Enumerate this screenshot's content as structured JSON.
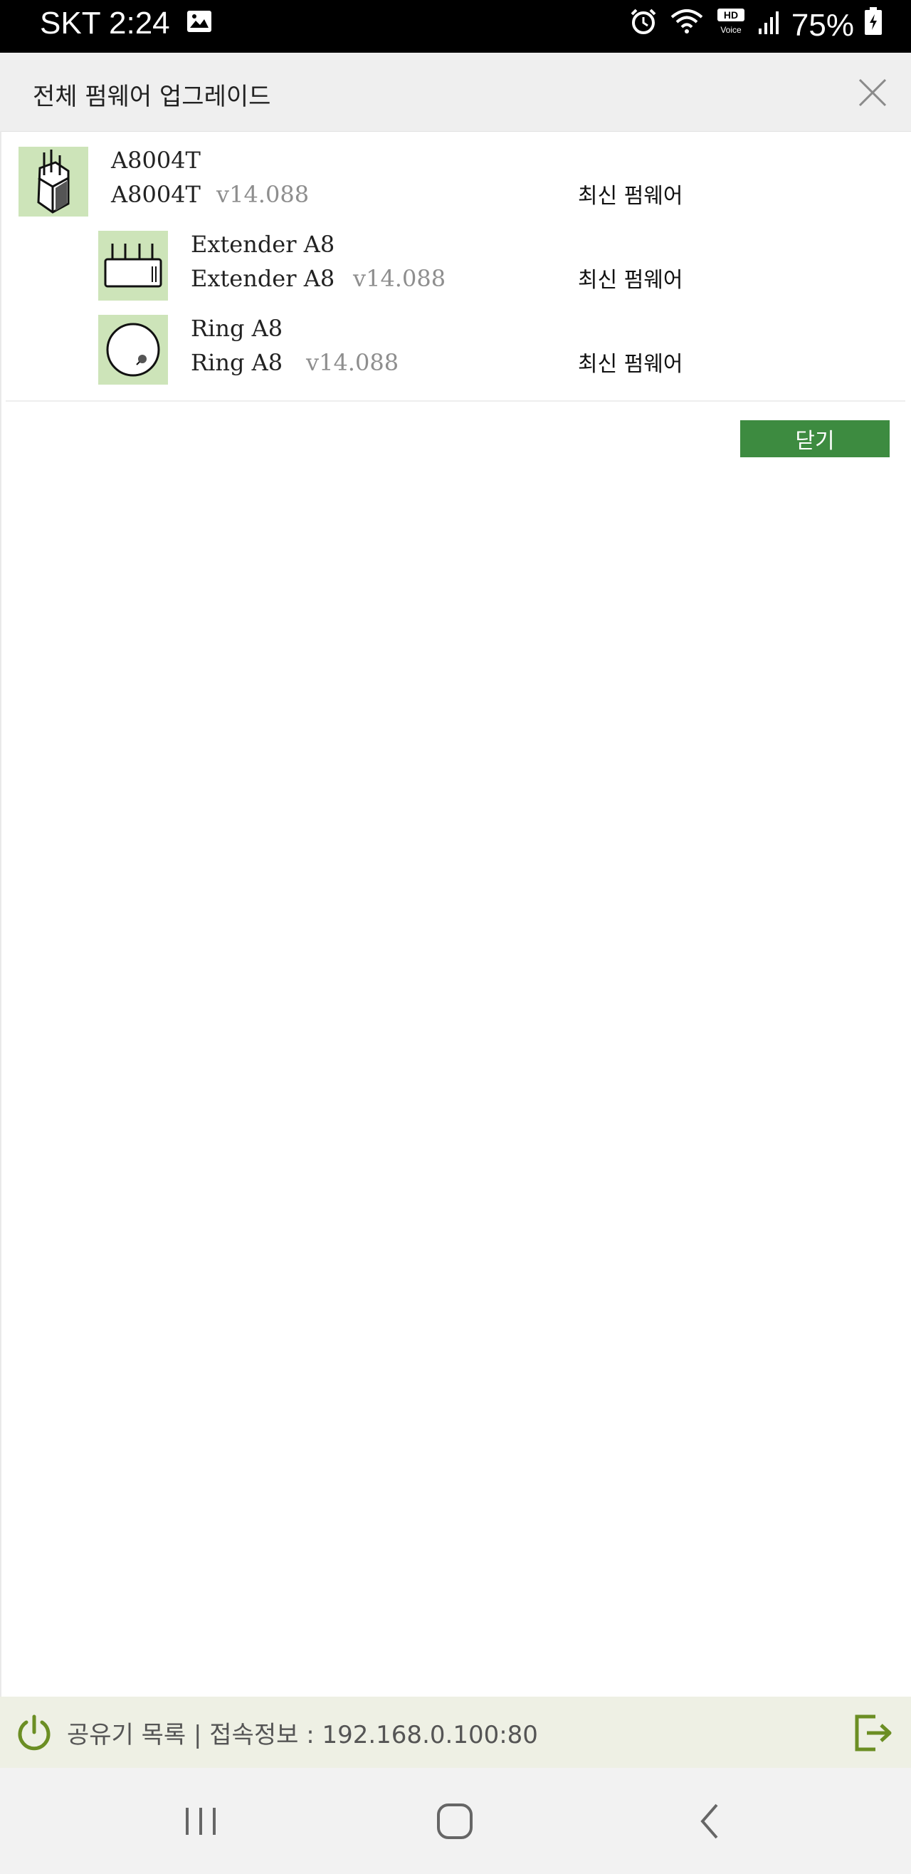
{
  "status_bar": {
    "carrier_time": "SKT 2:24",
    "battery": "75%",
    "icons": [
      "image-icon",
      "alarm-icon",
      "wifi-icon",
      "hd-voice-icon",
      "signal-icon",
      "battery-icon"
    ]
  },
  "dialog": {
    "title": "전체 펌웨어 업그레이드",
    "close_icon": "close-icon"
  },
  "devices": [
    {
      "name": "A8004T",
      "model": "A8004T",
      "version": "v14.088",
      "status": "최신 펌웨어",
      "icon": "router-icon"
    },
    {
      "name": "Extender A8",
      "model": "Extender A8",
      "version": "v14.088",
      "status": "최신 펌웨어",
      "icon": "extender-icon"
    },
    {
      "name": "Ring A8",
      "model": "Ring A8",
      "version": "v14.088",
      "status": "최신 펌웨어",
      "icon": "ring-icon"
    }
  ],
  "buttons": {
    "close": "닫기"
  },
  "info_bar": {
    "text": "공유기 목록  |  접속정보 : 192.168.0.100:80"
  },
  "colors": {
    "accent_green": "#3d8b40",
    "thumb_bg": "#cde4b9",
    "power_icon": "#6b8e23"
  }
}
